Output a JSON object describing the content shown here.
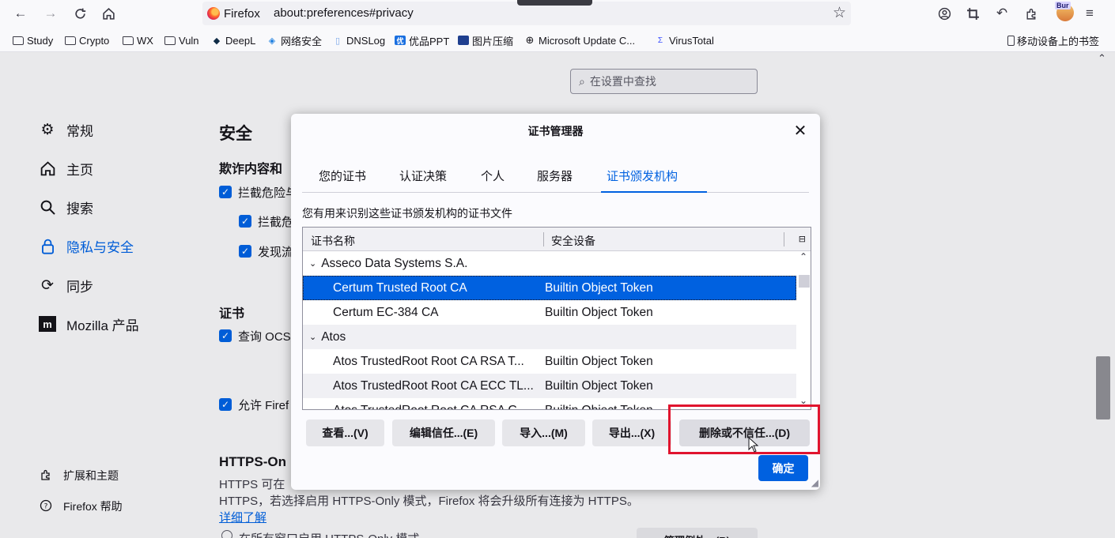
{
  "toolbar": {
    "identity_label": "Firefox",
    "url": "about:preferences#privacy",
    "badge_text": "Bur"
  },
  "bookmarks": {
    "items": [
      {
        "label": "Study",
        "icon": "folder-icon"
      },
      {
        "label": "Crypto",
        "icon": "folder-icon"
      },
      {
        "label": "WX",
        "icon": "folder-icon"
      },
      {
        "label": "Vuln",
        "icon": "folder-icon"
      },
      {
        "label": "DeepL",
        "icon": "deepl-icon"
      },
      {
        "label": "网络安全",
        "icon": "shield-bookmark-icon"
      },
      {
        "label": "DNSLog",
        "icon": "page-icon"
      },
      {
        "label": "优品PPT",
        "icon": "youpin-icon"
      },
      {
        "label": "图片压缩",
        "icon": "image-tool-icon"
      },
      {
        "label": "Microsoft Update C...",
        "icon": "globe-icon"
      },
      {
        "label": "VirusTotal",
        "icon": "virustotal-icon"
      }
    ],
    "mobile_label": "移动设备上的书签"
  },
  "prefs": {
    "search_placeholder": "在设置中查找",
    "nav": [
      {
        "label": "常规",
        "icon": "gear-icon"
      },
      {
        "label": "主页",
        "icon": "home-icon"
      },
      {
        "label": "搜索",
        "icon": "search-icon"
      },
      {
        "label": "隐私与安全",
        "icon": "lock-icon"
      },
      {
        "label": "同步",
        "icon": "sync-icon"
      },
      {
        "label": "Mozilla 产品",
        "icon": "mozilla-icon"
      }
    ],
    "nav_bottom": [
      {
        "label": "扩展和主题",
        "icon": "puzzle-icon"
      },
      {
        "label": "Firefox 帮助",
        "icon": "help-icon"
      }
    ],
    "section_title": "安全",
    "deceptive_heading": "欺诈内容和",
    "cb_block_dangerous": "拦截危险与",
    "cb_block_downloads": "拦截危",
    "cb_warn_unwanted": "发现流",
    "cert_heading": "证书",
    "cb_ocsp": "查询 OCS",
    "cb_allow_firefox": "允许 Firef",
    "https_heading": "HTTPS-On",
    "https_line1": "HTTPS 可在",
    "https_line2": "HTTPS，若选择启用 HTTPS-Only 模式，Firefox 将会升级所有连接为 HTTPS。",
    "learn_more": "详细了解",
    "radio_all_windows": "在所有窗口启用 HTTPS-Only 模式",
    "manage_exceptions": "管理例外…(R)"
  },
  "dialog": {
    "title": "证书管理器",
    "tabs": [
      "您的证书",
      "认证决策",
      "个人",
      "服务器",
      "证书颁发机构"
    ],
    "active_tab": "证书颁发机构",
    "description": "您有用来识别这些证书颁发机构的证书文件",
    "columns": [
      "证书名称",
      "安全设备"
    ],
    "rows": [
      {
        "type": "group",
        "name": "Asseco Data Systems S.A."
      },
      {
        "type": "cert",
        "name": "Certum Trusted Root CA",
        "device": "Builtin Object Token",
        "selected": true
      },
      {
        "type": "cert",
        "name": "Certum EC-384 CA",
        "device": "Builtin Object Token"
      },
      {
        "type": "group",
        "name": "Atos"
      },
      {
        "type": "cert",
        "name": "Atos TrustedRoot Root CA RSA T...",
        "device": "Builtin Object Token"
      },
      {
        "type": "cert",
        "name": "Atos TrustedRoot Root CA ECC TL...",
        "device": "Builtin Object Token"
      },
      {
        "type": "cert",
        "name": "Atos TrustedRoot Root CA RSA G...",
        "device": "Builtin Object Token"
      }
    ],
    "buttons": {
      "view": "查看...(V)",
      "edit_trust": "编辑信任...(E)",
      "import": "导入...(M)",
      "export": "导出...(X)",
      "delete_distrust": "删除或不信任...(D)",
      "ok": "确定"
    }
  },
  "colors": {
    "accent": "#0061e0",
    "highlight_box": "#e0142e"
  }
}
